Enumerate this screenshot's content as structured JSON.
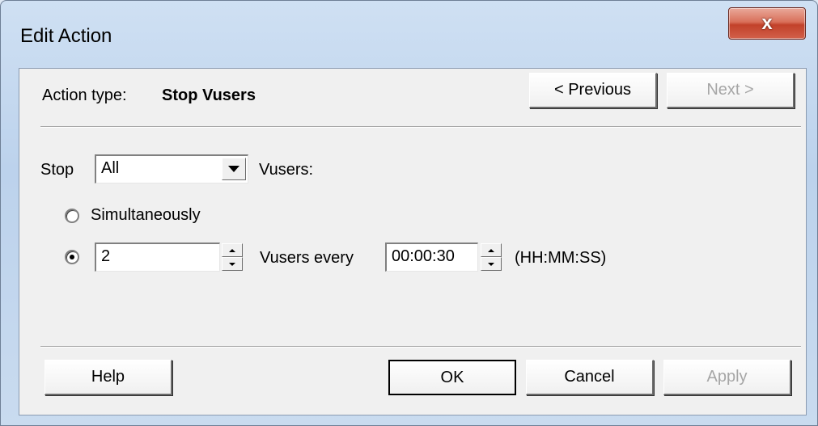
{
  "window": {
    "title": "Edit Action",
    "close_label": "x"
  },
  "header": {
    "action_type_label": "Action type:",
    "action_type_value": "Stop Vusers",
    "previous_label": "< Previous",
    "next_label": "Next >"
  },
  "form": {
    "stop_label": "Stop",
    "stop_select_value": "All",
    "vusers_label": "Vusers:",
    "simultaneously_label": "Simultaneously",
    "simultaneously_selected": false,
    "batch_selected": true,
    "batch_count_value": "2",
    "vusers_every_label": "Vusers every",
    "interval_value": "00:00:30",
    "interval_format_label": "(HH:MM:SS)"
  },
  "footer": {
    "help_label": "Help",
    "ok_label": "OK",
    "cancel_label": "Cancel",
    "apply_label": "Apply"
  }
}
